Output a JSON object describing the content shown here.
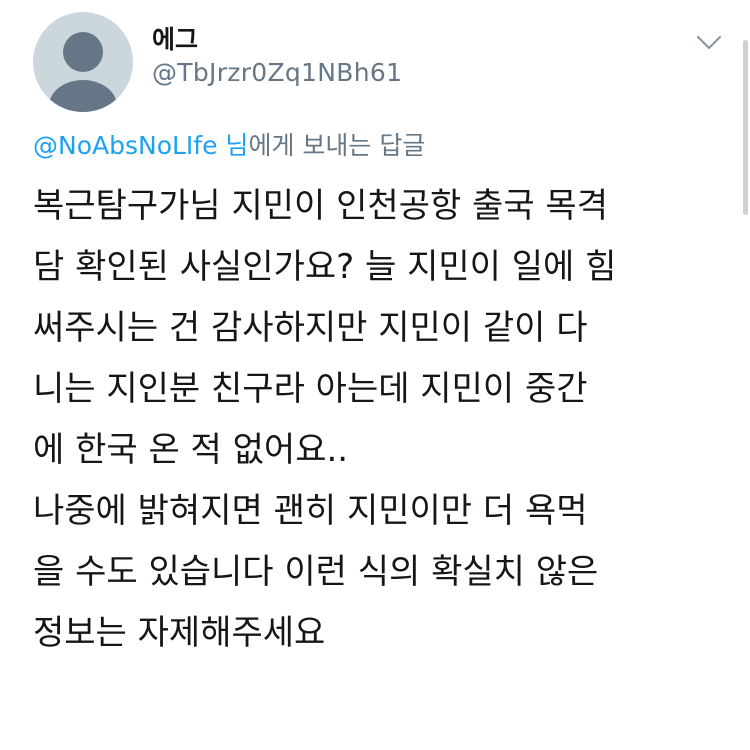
{
  "header": {
    "display_name": "에그",
    "handle": "@TbJrzr0Zq1NBh61",
    "avatar_icon": "default-profile-icon",
    "menu_icon": "chevron-down-icon"
  },
  "reply_context": {
    "mention": "@NoAbsNoLIfe",
    "suffix_pre": " 님",
    "suffix": "에게 보내는 답글"
  },
  "tweet": {
    "lines": [
      "복근탐구가님 지민이 인천공항 출국 목격",
      "담 확인된 사실인가요? 늘 지민이 일에 힘",
      "써주시는 건 감사하지만 지민이 같이 다",
      "니는 지인분 친구라 아는데 지민이 중간",
      "에 한국 온 적 없어요..",
      "나중에 밝혀지면 괜히 지민이만 더 욕먹",
      "을 수도 있습니다 이런 식의 확실치 않은",
      "정보는 자제해주세요"
    ]
  },
  "colors": {
    "link": "#1da1f2",
    "secondary_text": "#657786",
    "primary_text": "#14171a",
    "avatar_bg": "#ccd6dd",
    "avatar_fg": "#657786"
  }
}
